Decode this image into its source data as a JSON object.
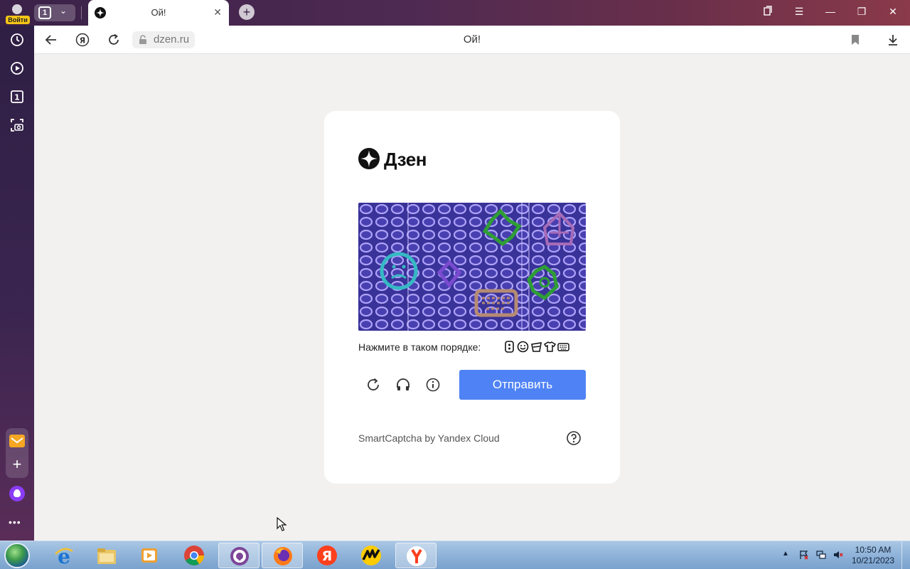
{
  "browser": {
    "profile_badge": "Войти",
    "tab_count": "1",
    "tab": {
      "title": "Ой!"
    },
    "address": {
      "url": "dzen.ru",
      "page_title": "Ой!"
    }
  },
  "page": {
    "logo_text": "Дзен",
    "captcha": {
      "instruction": "Нажмите в таком порядке:",
      "order_icons": [
        "robot-icon",
        "smiley-icon",
        "bucket-icon",
        "tshirt-icon",
        "keyboard-icon"
      ],
      "submit_label": "Отправить",
      "brand": "SmartCaptcha by Yandex Cloud"
    }
  },
  "taskbar": {
    "apps": [
      "internet-explorer",
      "file-explorer",
      "media-player",
      "chrome",
      "tor-browser",
      "firefox",
      "yandex",
      "yandex-music",
      "yandex-browser"
    ],
    "time": "10:50 AM",
    "date": "10/21/2023"
  },
  "colors": {
    "accent": "#4f83f5",
    "sidebar": "#3a2550"
  }
}
